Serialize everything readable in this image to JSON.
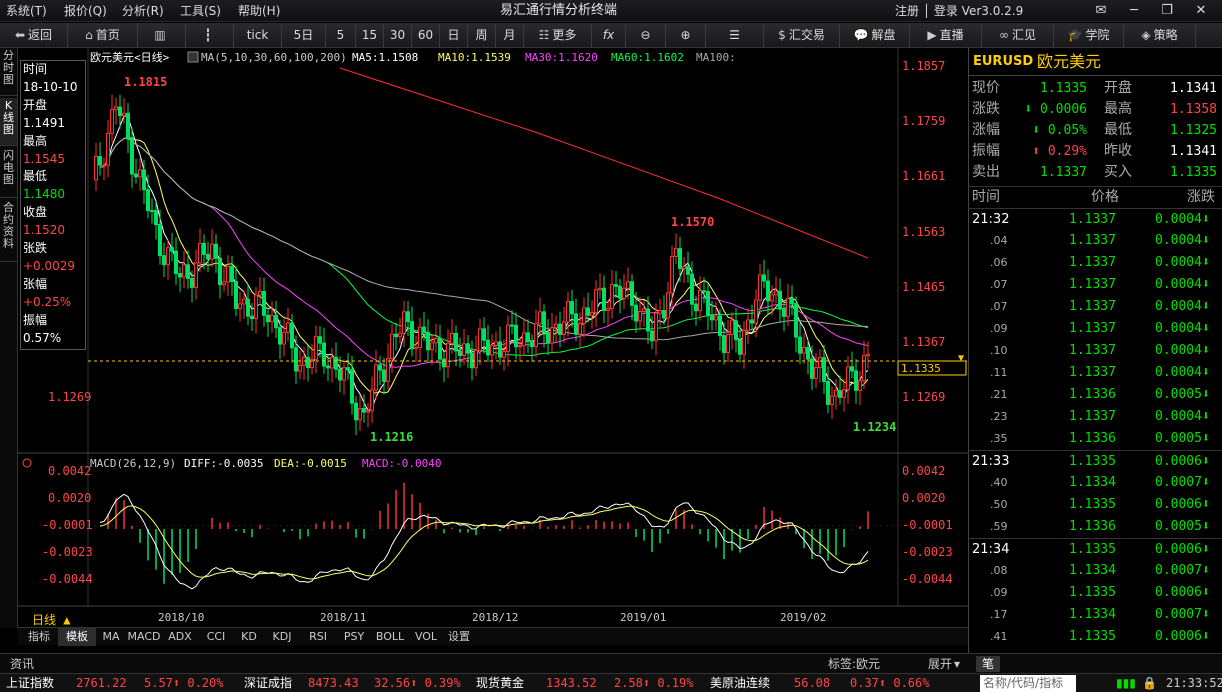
{
  "menubar": {
    "items": [
      "系统(T)",
      "报价(Q)",
      "分析(R)",
      "工具(S)",
      "帮助(H)"
    ],
    "title": "易汇通行情分析终端",
    "right": "注册 │ 登录  Ver3.0.2.9"
  },
  "toolbar": {
    "back": "返回",
    "home": "首页",
    "tick": "tick",
    "periods": [
      "5日",
      "5",
      "15",
      "30",
      "60",
      "日",
      "周",
      "月"
    ],
    "more": "更多",
    "fx": "fx",
    "trade": "汇交易",
    "analysis": "解盘",
    "live": "直播",
    "huijian": "汇见",
    "school": "学院",
    "strategy": "策略"
  },
  "sidetabs": [
    "分时图",
    "K线图",
    "闪电图",
    "合约资料"
  ],
  "chart": {
    "title": "欧元美元<日线>",
    "ma_params": "MA(5,10,30,60,100,200)",
    "ma5": "MA5:1.1508",
    "ma10": "MA10:1.1539",
    "ma30": "MA30:1.1620",
    "ma60": "MA60:1.1602",
    "ma100": "MA100:",
    "price_ticks": [
      "1.1857",
      "1.1759",
      "1.1661",
      "1.1563",
      "1.1465",
      "1.1367",
      "1.1269"
    ],
    "left_tick": "1.1269",
    "current": "1.1335",
    "hi_label": "1.1815",
    "lo_label": "1.1216",
    "mid_high": "1.1570",
    "recent_low": "1.1234",
    "macd_label": "MACD(26,12,9)",
    "diff": "DIFF:-0.0035",
    "dea": "DEA:-0.0015",
    "macd": "MACD:-0.0040",
    "macd_ticks": [
      "0.0042",
      "0.0020",
      "-0.0001",
      "-0.0023",
      "-0.0044"
    ],
    "dates": [
      "2018/10",
      "2018/11",
      "2018/12",
      "2019/01",
      "2019/02"
    ],
    "period_label": "日线 ▲",
    "colors": {
      "up": "#ff3030",
      "down": "#00e060",
      "ma5": "#ffffff",
      "ma10": "#ffff66",
      "ma30": "#ff44ff",
      "ma60": "#00ff44",
      "ma100": "#aaaaaa",
      "ma200": "#ff3030"
    }
  },
  "infobox": [
    [
      "时间",
      "white"
    ],
    [
      "18-10-10",
      "white"
    ],
    [
      "开盘",
      "white"
    ],
    [
      "1.1491",
      "white"
    ],
    [
      "最高",
      "white"
    ],
    [
      "1.1545",
      "red"
    ],
    [
      "最低",
      "white"
    ],
    [
      "1.1480",
      "green"
    ],
    [
      "收盘",
      "white"
    ],
    [
      "1.1520",
      "red"
    ],
    [
      "张跌",
      "white"
    ],
    [
      "+0.0029",
      "red"
    ],
    [
      "张幅",
      "white"
    ],
    [
      "+0.25%",
      "red"
    ],
    [
      "振幅",
      "white"
    ],
    [
      "0.57%",
      "white"
    ]
  ],
  "bottomtabs": [
    "指标",
    "模板",
    "MA",
    "MACD",
    "ADX",
    "CCI",
    "KD",
    "KDJ",
    "RSI",
    "PSY",
    "BOLL",
    "VOL",
    "设置"
  ],
  "quote": {
    "code": "EURUSD",
    "name": "欧元美元",
    "rows": [
      [
        "现价",
        "1.1335",
        "green",
        "开盘",
        "1.1341",
        "white"
      ],
      [
        "涨跌",
        "⬇ 0.0006",
        "green",
        "最高",
        "1.1358",
        "red"
      ],
      [
        "涨幅",
        "⬇ 0.05%",
        "green",
        "最低",
        "1.1325",
        "green"
      ],
      [
        "振幅",
        "⬆ 0.29%",
        "red",
        "昨收",
        "1.1341",
        "white"
      ],
      [
        "卖出",
        "1.1337",
        "green",
        "买入",
        "1.1335",
        "green"
      ]
    ],
    "list_header": [
      "时间",
      "价格",
      "涨跌"
    ],
    "ticks": [
      [
        "21:32",
        "1.1337",
        "0.0004⬇"
      ],
      [
        ".04",
        "1.1337",
        "0.0004⬇"
      ],
      [
        ".06",
        "1.1337",
        "0.0004⬇"
      ],
      [
        ".07",
        "1.1337",
        "0.0004⬇"
      ],
      [
        ".07",
        "1.1337",
        "0.0004⬇"
      ],
      [
        ".09",
        "1.1337",
        "0.0004⬇"
      ],
      [
        ".10",
        "1.1337",
        "0.0004⬇"
      ],
      [
        ".11",
        "1.1337",
        "0.0004⬇"
      ],
      [
        ".21",
        "1.1336",
        "0.0005⬇"
      ],
      [
        ".23",
        "1.1337",
        "0.0004⬇"
      ],
      [
        ".35",
        "1.1336",
        "0.0005⬇"
      ],
      [
        "21:33",
        "1.1335",
        "0.0006⬇"
      ],
      [
        ".40",
        "1.1334",
        "0.0007⬇"
      ],
      [
        ".50",
        "1.1335",
        "0.0006⬇"
      ],
      [
        ".59",
        "1.1336",
        "0.0005⬇"
      ],
      [
        "21:34",
        "1.1335",
        "0.0006⬇"
      ],
      [
        ".08",
        "1.1334",
        "0.0007⬇"
      ],
      [
        ".09",
        "1.1335",
        "0.0006⬇"
      ],
      [
        ".17",
        "1.1334",
        "0.0007⬇"
      ],
      [
        ".41",
        "1.1335",
        "0.0006⬇"
      ]
    ]
  },
  "statusbar": {
    "news": "资讯",
    "tag": "标签:欧元",
    "expand": "展开",
    "pen": "笔"
  },
  "ticker": {
    "items": [
      [
        "上证指数",
        "2761.22",
        "5.57⬆ 0.20%"
      ],
      [
        "深证成指",
        "8473.43",
        "32.56⬆ 0.39%"
      ],
      [
        "现货黄金",
        "1343.52",
        "2.58⬆ 0.19%"
      ],
      [
        "美原油连续",
        "56.08",
        "0.37⬆ 0.66%"
      ]
    ],
    "search": "名称/代码/指标",
    "time": "21:33:52"
  }
}
